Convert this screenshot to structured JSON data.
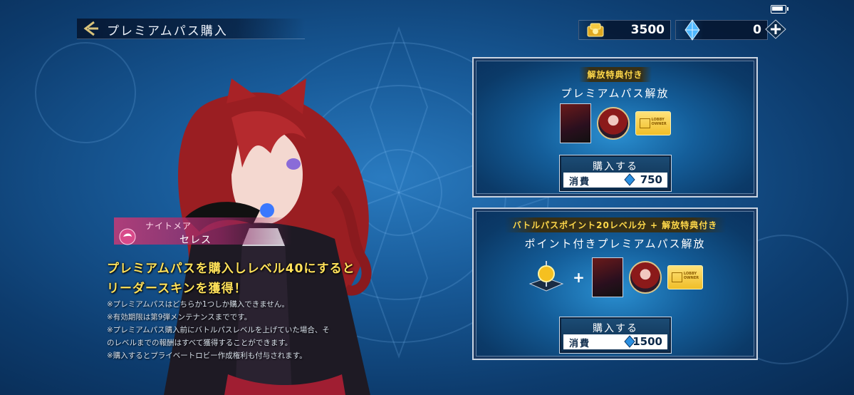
{
  "header": {
    "title": "プレミアムパス購入",
    "gold_amount": "3500",
    "gem_amount": "0"
  },
  "character": {
    "class_label": "ナイトメア",
    "name": "セレス"
  },
  "promo": {
    "line1": "プレミアムパスを購入しレベル40にすると",
    "line2": "リーダースキンを獲得！",
    "notes": [
      "※プレミアムパスはどちらか1つしか購入できません。",
      "※有効期限は第9弾メンテナンスまでです。",
      "※プレミアムパス購入前にバトルパスレベルを上げていた場合、そ",
      "のレベルまでの報酬はすべて獲得することができます。",
      "※購入するとプライベートロビー作成権利も付与されます。"
    ]
  },
  "offers": [
    {
      "ribbon": "解放特典付き",
      "title": "プレミアムパス解放",
      "items": [
        "character-card",
        "character-icon",
        "lobby-owner-ticket"
      ],
      "buy_label": "購入する",
      "cost_label": "消費",
      "cost_value": "750"
    },
    {
      "ribbon": "バトルパスポイント20レベル分 + 解放特典付き",
      "title": "ポイント付きプレミアムパス解放",
      "items": [
        "battle-pass-point-orb",
        "character-card",
        "character-icon",
        "lobby-owner-ticket"
      ],
      "buy_label": "購入する",
      "cost_label": "消費",
      "cost_value": "1500"
    }
  ],
  "lobby_ticket_text": "LOBBY\nOWNER",
  "colors": {
    "promo_yellow": "#ffe15a",
    "ribbon_gold": "#ffd84a",
    "nameplate_pink": "#be3c78",
    "panel_blue": "#145e9a"
  }
}
